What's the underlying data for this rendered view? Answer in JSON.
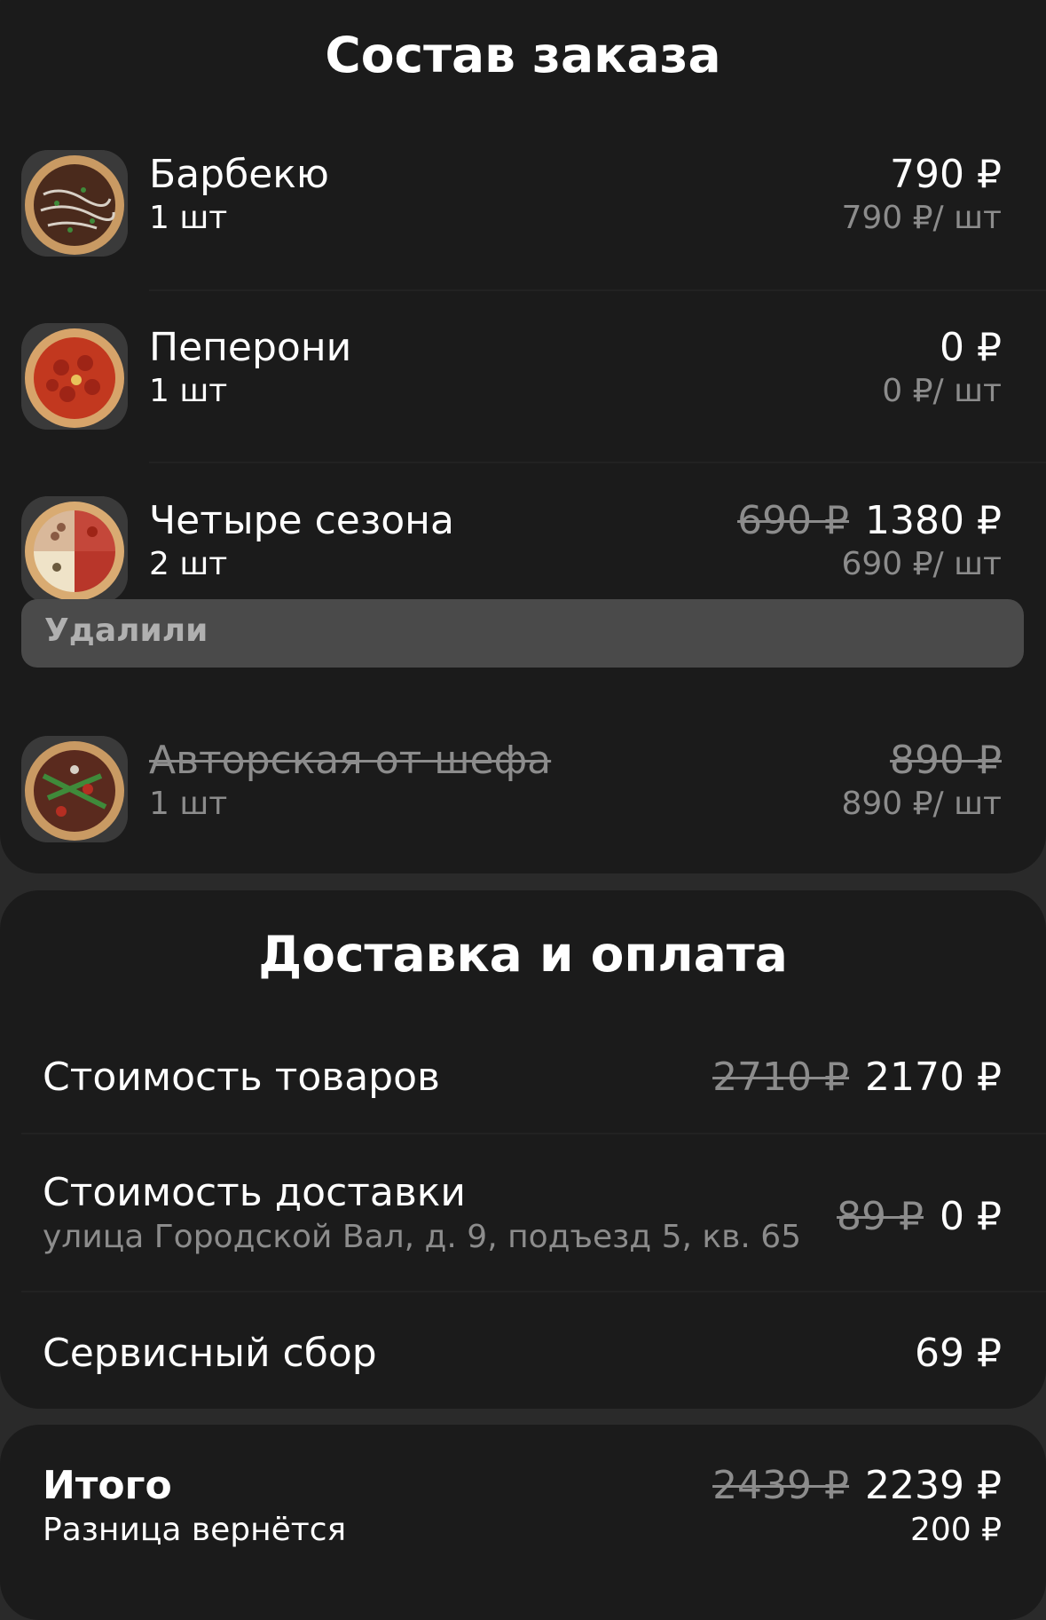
{
  "order": {
    "title": "Состав заказа",
    "items": [
      {
        "name": "Барбекю",
        "qty": "1 шт",
        "price": "790 ₽",
        "unit_price": "790 ₽/ шт",
        "thumb_icon": "pizza-bbq-icon"
      },
      {
        "name": "Пеперони",
        "qty": "1 шт",
        "price": "0 ₽",
        "unit_price": "0 ₽/ шт",
        "thumb_icon": "pizza-pepperoni-icon"
      },
      {
        "name": "Четыре сезона",
        "qty": "2 шт",
        "old_price": "690 ₽",
        "price": "1380 ₽",
        "unit_price": "690 ₽/ шт",
        "thumb_icon": "pizza-four-seasons-icon"
      }
    ],
    "removed_label": "Удалили",
    "removed_items": [
      {
        "name": "Авторская от шефа",
        "qty": "1 шт",
        "price": "890 ₽",
        "unit_price": "890 ₽/ шт",
        "thumb_icon": "pizza-chef-icon"
      }
    ]
  },
  "delivery": {
    "title": "Доставка и оплата",
    "goods": {
      "label": "Стоимость товаров",
      "old_price": "2710 ₽",
      "price": "2170 ₽"
    },
    "shipping": {
      "label": "Стоимость доставки",
      "address": "улица Городской Вал, д. 9, подъезд 5, кв. 65",
      "old_price": "89 ₽",
      "price": "0 ₽"
    },
    "service": {
      "label": "Сервисный сбор",
      "price": "69 ₽"
    }
  },
  "total": {
    "label": "Итого",
    "old_price": "2439 ₽",
    "price": "2239 ₽",
    "refund_label": "Разница вернётся",
    "refund_amount": "200 ₽"
  },
  "colors": {
    "background": "#2a2a2a",
    "card": "#1b1b1b",
    "text": "#ffffff",
    "secondary_text": "#8c8c8c",
    "removed_bar": "#4a4a4a"
  }
}
